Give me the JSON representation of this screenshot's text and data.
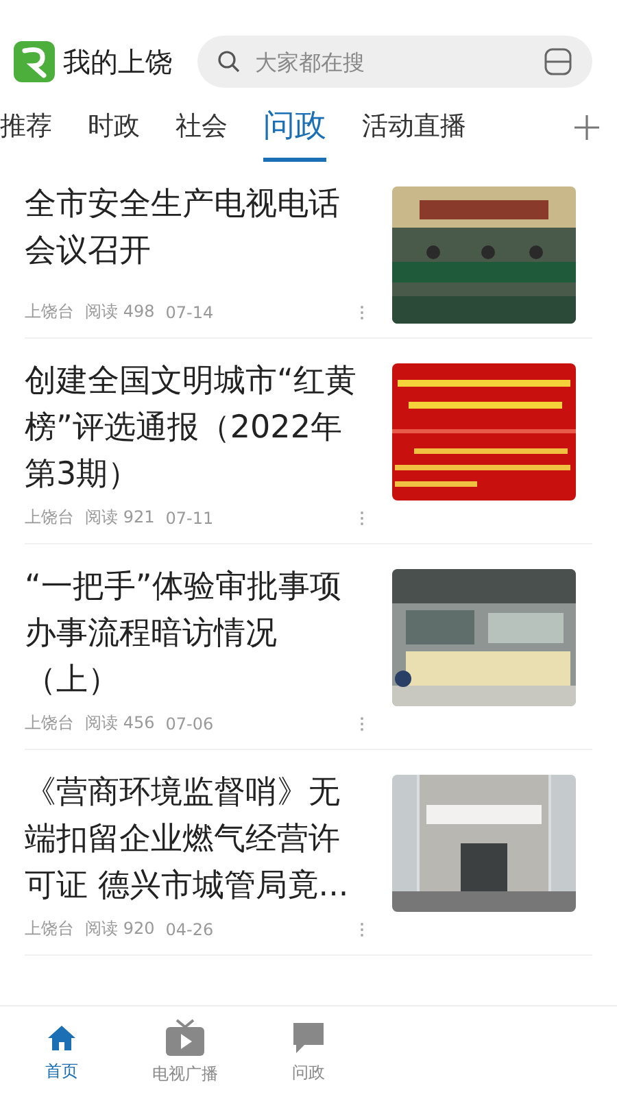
{
  "app": {
    "title": "我的上饶"
  },
  "search": {
    "placeholder": "大家都在搜"
  },
  "tabs": [
    {
      "label": "推荐",
      "selected": false
    },
    {
      "label": "时政",
      "selected": false
    },
    {
      "label": "社会",
      "selected": false
    },
    {
      "label": "问政",
      "selected": true
    },
    {
      "label": "活动直播",
      "selected": false
    }
  ],
  "articles": [
    {
      "title": "全市安全生产电视电话会议召开",
      "source": "上饶台",
      "reads": "阅读 498",
      "date": "07-14"
    },
    {
      "title": "创建全国文明城市“红黄榜”评选通报（2022年第3期）",
      "source": "上饶台",
      "reads": "阅读 921",
      "date": "07-11"
    },
    {
      "title": "“一把手”体验审批事项办事流程暗访情况（上）",
      "source": "上饶台",
      "reads": "阅读 456",
      "date": "07-06"
    },
    {
      "title": "《营商环境监督哨》无端扣留企业燃气经营许可证 德兴市城管局竟...",
      "source": "上饶台",
      "reads": "阅读 920",
      "date": "04-26"
    }
  ],
  "bottom_nav": [
    {
      "label": "首页",
      "selected": true
    },
    {
      "label": "电视广播",
      "selected": false
    },
    {
      "label": "问政",
      "selected": false
    }
  ]
}
